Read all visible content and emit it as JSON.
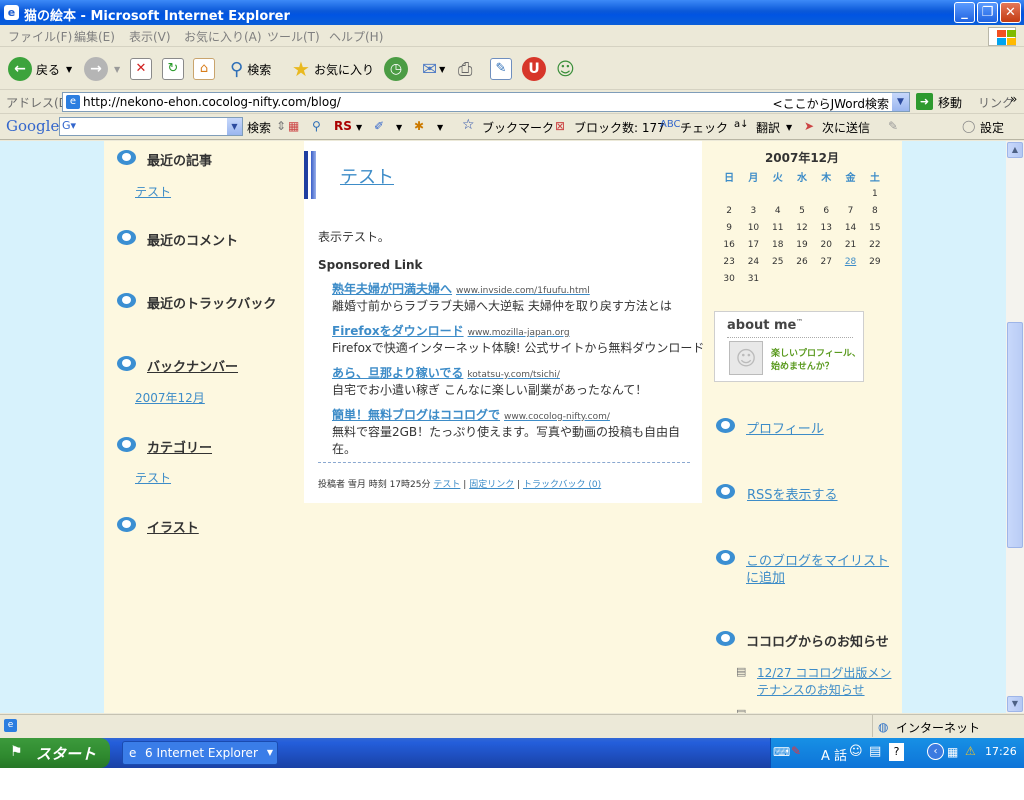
{
  "window": {
    "title": "猫の絵本 - Microsoft Internet Explorer",
    "buttons": [
      "_",
      "❐",
      "✕"
    ]
  },
  "menu": [
    "ファイル(F)",
    "編集(E)",
    "表示(V)",
    "お気に入り(A)",
    "ツール(T)",
    "ヘルプ(H)"
  ],
  "toolbar": {
    "back": "戻る",
    "search": "検索",
    "favorites": "お気に入り"
  },
  "address": {
    "label": "アドレス(D)",
    "url": "http://nekono-ehon.cocolog-nifty.com/blog/",
    "jword": "<ここからJWord検索",
    "go": "移動",
    "links": "リンク"
  },
  "google_bar": {
    "logo": "Google",
    "search": "検索",
    "rs": "RS",
    "bookmark": "ブックマーク",
    "blocked": "ブロック数: 177",
    "check": "チェック",
    "translate": "翻訳",
    "send": "次に送信",
    "settings": "設定"
  },
  "left_sidebar": {
    "recent_posts": {
      "title": "最近の記事",
      "items": [
        "テスト"
      ]
    },
    "recent_comments": {
      "title": "最近のコメント"
    },
    "recent_trackbacks": {
      "title": "最近のトラックバック"
    },
    "backnumber": {
      "title": "バックナンバー",
      "items": [
        "2007年12月"
      ]
    },
    "category": {
      "title": "カテゴリー",
      "items": [
        "テスト"
      ]
    },
    "illust": {
      "title": "イラスト"
    }
  },
  "post": {
    "title": "テスト",
    "body": "表示テスト。",
    "sponsored_label": "Sponsored Link",
    "ads": [
      {
        "title": "熟年夫婦が円満夫婦へ",
        "url": "www.invside.com/1fuufu.html",
        "desc": "離婚寸前からラブラブ夫婦へ大逆転 夫婦仲を取り戻す方法とは"
      },
      {
        "title": "Firefoxをダウンロード",
        "url": "www.mozilla-japan.org",
        "desc": "Firefoxで快適インターネット体験! 公式サイトから無料ダウンロード"
      },
      {
        "title": "あら、旦那より稼いでる",
        "url": "kotatsu-y.com/tsichi/",
        "desc": "自宅でお小遣い稼ぎ こんなに楽しい副業があったなんて！"
      },
      {
        "title": "簡単！無料ブログはココログで",
        "url": "www.cocolog-nifty.com/",
        "desc": "無料で容量2GB！たっぷり使えます。写真や動画の投稿も自由自",
        "desc2": "在。"
      }
    ],
    "footer_meta": "投稿者 雪月 時刻 17時25分",
    "footer_links": [
      "テスト",
      "固定リンク",
      "トラックバック (0)"
    ]
  },
  "calendar": {
    "title": "2007年12月",
    "weekdays": [
      "日",
      "月",
      "火",
      "水",
      "木",
      "金",
      "土"
    ],
    "weeks": [
      [
        "",
        "",
        "",
        "",
        "",
        "",
        "1"
      ],
      [
        "2",
        "3",
        "4",
        "5",
        "6",
        "7",
        "8"
      ],
      [
        "9",
        "10",
        "11",
        "12",
        "13",
        "14",
        "15"
      ],
      [
        "16",
        "17",
        "18",
        "19",
        "20",
        "21",
        "22"
      ],
      [
        "23",
        "24",
        "25",
        "26",
        "27",
        "28",
        "29"
      ],
      [
        "30",
        "31",
        "",
        "",
        "",
        "",
        ""
      ]
    ],
    "linked_day": "28"
  },
  "aboutme": {
    "logo": "about me",
    "tm": "™",
    "text1": "楽しいプロフィール、",
    "text2": "始めませんか？"
  },
  "right_sidebar": {
    "profile": "プロフィール",
    "rss": "RSSを表示する",
    "mylist_1": "このブログをマイリスト",
    "mylist_2": "に追加",
    "news_title": "ココログからのお知らせ",
    "news_1": "12/27 ココログ出版メン",
    "news_2": "テナンスのお知らせ"
  },
  "status": {
    "zone": "インターネット"
  },
  "taskbar": {
    "start": "スタート",
    "task": "6 Internet Explorer",
    "ime": "A 話",
    "clock": "17:26"
  }
}
